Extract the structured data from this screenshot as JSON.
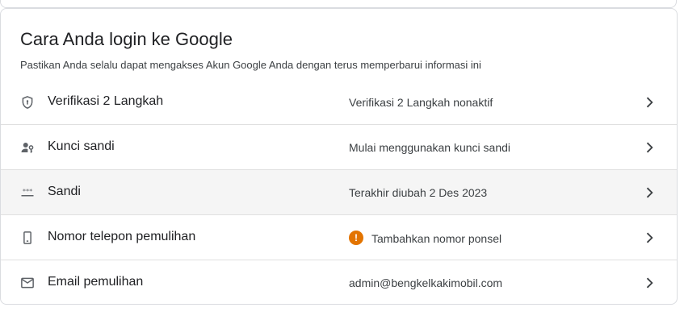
{
  "section": {
    "title": "Cara Anda login ke Google",
    "subtitle": "Pastikan Anda selalu dapat mengakses Akun Google Anda dengan terus memperbarui informasi ini"
  },
  "rows": [
    {
      "label": "Verifikasi 2 Langkah",
      "value": "Verifikasi 2 Langkah nonaktif",
      "icon": "shield-icon"
    },
    {
      "label": "Kunci sandi",
      "value": "Mulai menggunakan kunci sandi",
      "icon": "passkey-icon"
    },
    {
      "label": "Sandi",
      "value": "Terakhir diubah 2 Des 2023",
      "icon": "password-icon"
    },
    {
      "label": "Nomor telepon pemulihan",
      "value": "Tambahkan nomor ponsel",
      "icon": "phone-icon",
      "warning_symbol": "!"
    },
    {
      "label": "Email pemulihan",
      "value": "admin@bengkelkakimobil.com",
      "icon": "email-icon"
    }
  ],
  "colors": {
    "warning": "#e37400",
    "hover_row": "#f5f5f5",
    "divider": "#e0e0e0"
  }
}
